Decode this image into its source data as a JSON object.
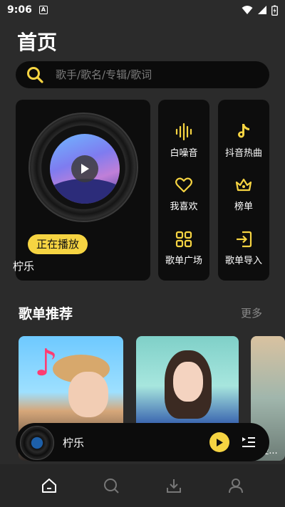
{
  "status_bar": {
    "time": "9:06",
    "notif_badge": "A"
  },
  "header": {
    "title": "首页"
  },
  "search": {
    "placeholder": "歌手/歌名/专辑/歌词"
  },
  "now_playing": {
    "badge": "正在播放",
    "song": "柠乐"
  },
  "grid": [
    {
      "label": "白噪音",
      "icon": "waveform-icon"
    },
    {
      "label": "抖音热曲",
      "icon": "tiktok-icon"
    },
    {
      "label": "我喜欢",
      "icon": "heart-icon"
    },
    {
      "label": "榜单",
      "icon": "crown-icon"
    },
    {
      "label": "歌单广场",
      "icon": "grid-icon"
    },
    {
      "label": "歌单导入",
      "icon": "import-icon"
    }
  ],
  "recommend": {
    "title": "歌单推荐",
    "more": "更多",
    "peek_text": "n轻..."
  },
  "mini_player": {
    "title": "柠乐"
  },
  "bottom_nav": [
    "home-icon",
    "search-icon",
    "download-icon",
    "profile-icon"
  ],
  "colors": {
    "accent": "#f6d442",
    "background": "#2b2b2b",
    "card": "#0d0d0d"
  }
}
